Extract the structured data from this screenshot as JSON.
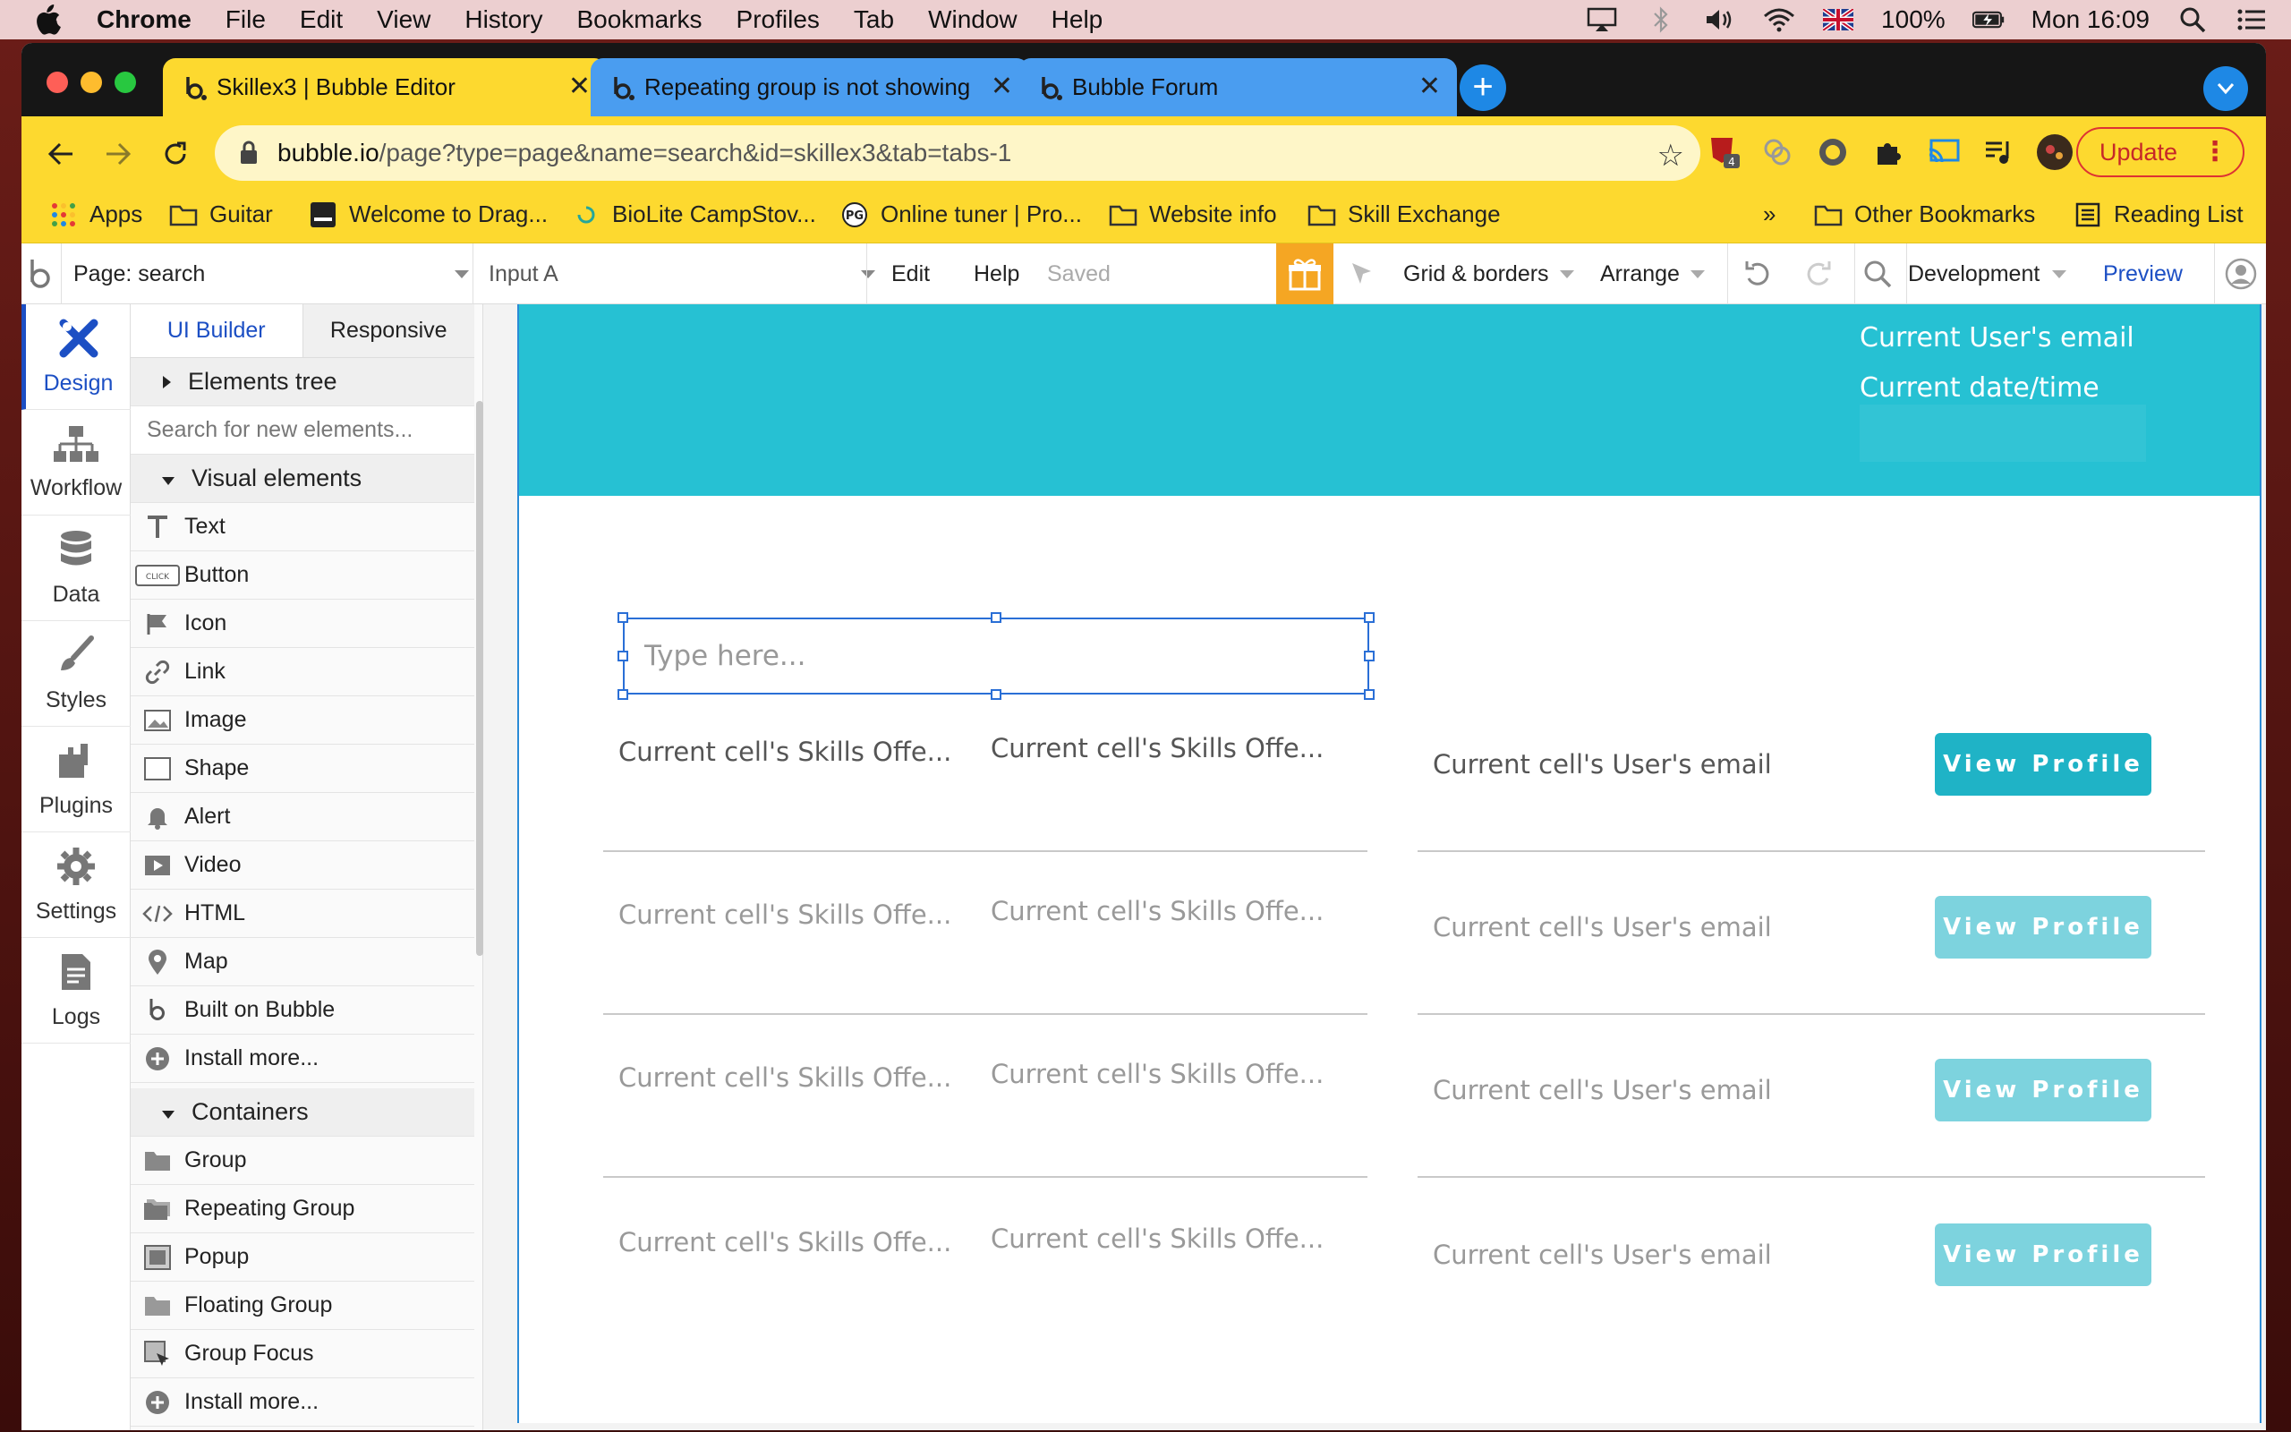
{
  "menubar": {
    "app": "Chrome",
    "items": [
      "File",
      "Edit",
      "View",
      "History",
      "Bookmarks",
      "Profiles",
      "Tab",
      "Window",
      "Help"
    ],
    "battery": "100%",
    "clock": "Mon 16:09"
  },
  "tabs": [
    {
      "title": "Skillex3 | Bubble Editor",
      "color": "#fdd92f",
      "active": true
    },
    {
      "title": "Repeating group is not showing",
      "color": "#4a9df0",
      "active": false
    },
    {
      "title": "Bubble Forum",
      "color": "#4a9df0",
      "active": false
    }
  ],
  "omnibox": {
    "host": "bubble.io",
    "path": "/page?type=page&name=search&id=skillex3&tab=tabs-1"
  },
  "extensions": {
    "badge": "4"
  },
  "update_label": "Update",
  "bookmarks": {
    "items": [
      "Apps",
      "Guitar",
      "Welcome to Drag...",
      "BioLite CampStov...",
      "Online tuner | Pro...",
      "Website info",
      "Skill Exchange"
    ],
    "overflow": "»",
    "other": "Other Bookmarks",
    "reading": "Reading List"
  },
  "editor": {
    "page_label": "Page: search",
    "element_label": "Input A",
    "edit": "Edit",
    "help": "Help",
    "saved": "Saved",
    "grid": "Grid & borders",
    "arrange": "Arrange",
    "dev": "Development",
    "preview": "Preview"
  },
  "rail": [
    {
      "label": "Design",
      "icon": "design-icon"
    },
    {
      "label": "Workflow",
      "icon": "workflow-icon"
    },
    {
      "label": "Data",
      "icon": "database-icon"
    },
    {
      "label": "Styles",
      "icon": "brush-icon"
    },
    {
      "label": "Plugins",
      "icon": "plugin-icon"
    },
    {
      "label": "Settings",
      "icon": "gear-icon"
    },
    {
      "label": "Logs",
      "icon": "document-icon"
    }
  ],
  "panel": {
    "tab_builder": "UI Builder",
    "tab_responsive": "Responsive",
    "tree": "Elements tree",
    "search_placeholder": "Search for new elements...",
    "visual_header": "Visual elements",
    "visual": [
      "Text",
      "Button",
      "Icon",
      "Link",
      "Image",
      "Shape",
      "Alert",
      "Video",
      "HTML",
      "Map",
      "Built on Bubble",
      "Install more..."
    ],
    "containers_header": "Containers",
    "containers": [
      "Group",
      "Repeating Group",
      "Popup",
      "Floating Group",
      "Group Focus",
      "Install more..."
    ]
  },
  "canvas": {
    "header_email": "Current User's email",
    "header_date": "Current date/time",
    "input_placeholder": "Type here...",
    "rows": [
      {
        "skill1": "Current cell's Skills Offe...",
        "skill2": "Current cell's Skills Offe...",
        "email": "Current cell's User's email",
        "button": "View Profile"
      },
      {
        "skill1": "Current cell's Skills Offe...",
        "skill2": "Current cell's Skills Offe...",
        "email": "Current cell's User's email",
        "button": "View Profile"
      },
      {
        "skill1": "Current cell's Skills Offe...",
        "skill2": "Current cell's Skills Offe...",
        "email": "Current cell's User's email",
        "button": "View Profile"
      },
      {
        "skill1": "Current cell's Skills Offe...",
        "skill2": "Current cell's Skills Offe...",
        "email": "Current cell's User's email",
        "button": "View Profile"
      }
    ]
  },
  "colors": {
    "accent": "#1c4fc4",
    "header_band": "#26c1d3",
    "button": "#1fb3c6",
    "chrome_yellow": "#fdd92f"
  }
}
